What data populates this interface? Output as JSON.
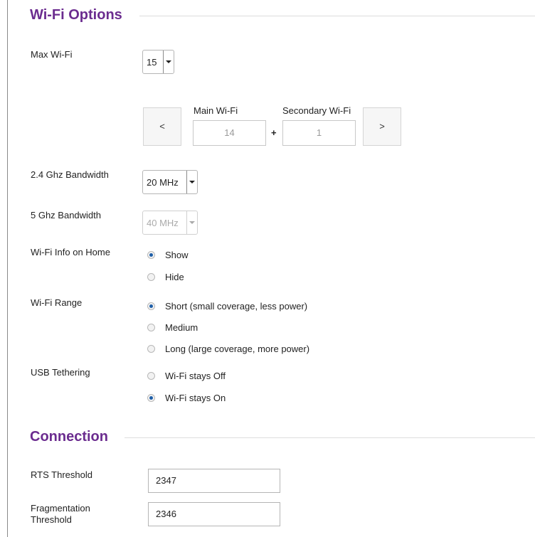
{
  "wifi_options": {
    "title": "Wi-Fi Options",
    "max_wifi": {
      "label": "Max Wi-Fi",
      "value": "15"
    },
    "split": {
      "prev_label": "<",
      "next_label": ">",
      "main_label": "Main Wi-Fi",
      "main_value": "14",
      "plus": "+",
      "secondary_label": "Secondary Wi-Fi",
      "secondary_value": "1"
    },
    "bw24": {
      "label": "2.4 Ghz Bandwidth",
      "value": "20 MHz"
    },
    "bw5": {
      "label": "5 Ghz Bandwidth",
      "value": "40 MHz",
      "disabled": true
    },
    "info_home": {
      "label": "Wi-Fi Info on Home",
      "options": [
        {
          "label": "Show",
          "selected": true
        },
        {
          "label": "Hide",
          "selected": false
        }
      ]
    },
    "range": {
      "label": "Wi-Fi Range",
      "options": [
        {
          "label": "Short (small coverage, less power)",
          "selected": true
        },
        {
          "label": "Medium",
          "selected": false
        },
        {
          "label": "Long (large coverage, more power)",
          "selected": false
        }
      ]
    },
    "usb": {
      "label": "USB Tethering",
      "options": [
        {
          "label": "Wi-Fi stays Off",
          "selected": false
        },
        {
          "label": "Wi-Fi stays On",
          "selected": true
        }
      ]
    }
  },
  "connection": {
    "title": "Connection",
    "rts": {
      "label": "RTS Threshold",
      "value": "2347"
    },
    "frag": {
      "label_line1": "Fragmentation",
      "label_line2": "Threshold",
      "value": "2346"
    }
  },
  "colors": {
    "heading": "#6b2c8f",
    "radio_selected": "#1f5fa8"
  }
}
